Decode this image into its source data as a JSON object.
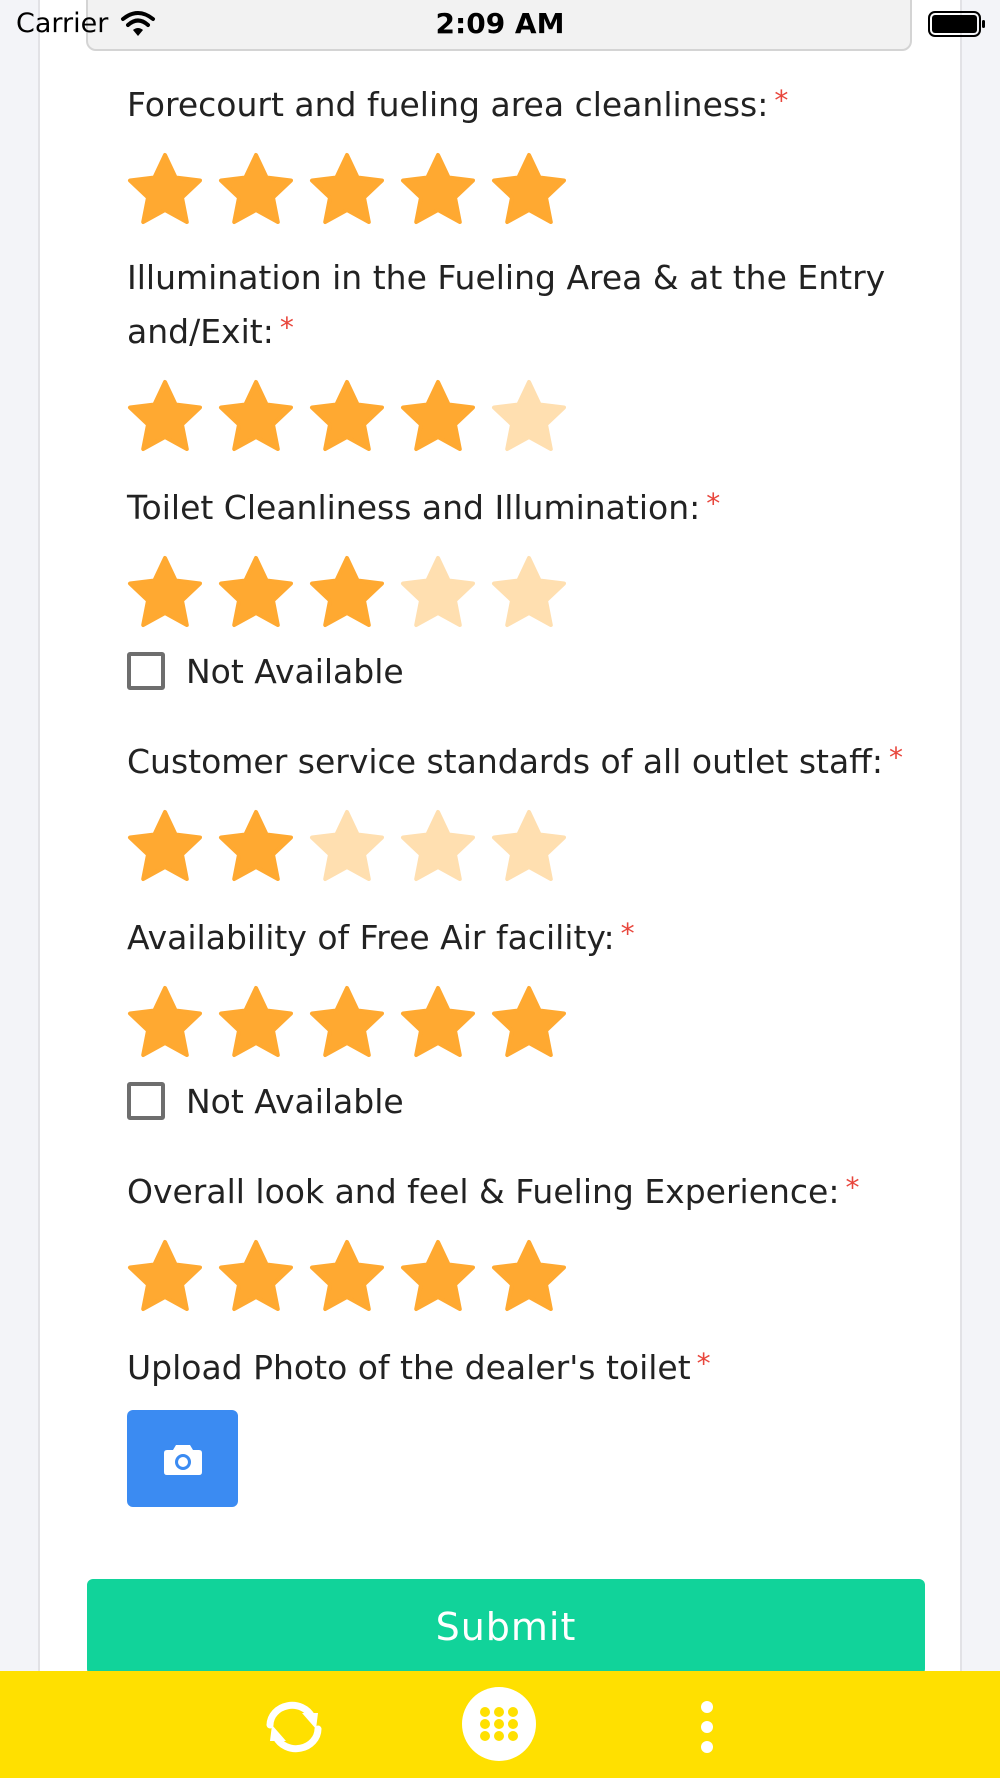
{
  "status_bar": {
    "carrier": "Carrier",
    "time": "2:09 AM"
  },
  "colors": {
    "star_filled": "#ffa931",
    "star_empty": "#ffdfb0",
    "required": "#e8463c",
    "camera_button": "#3b8bf2",
    "submit_button": "#11d39a",
    "bottom_bar": "#ffe000"
  },
  "questions": [
    {
      "label": "Forecourt and fueling area cleanliness:",
      "required": "*",
      "rating": 5,
      "max": 5
    },
    {
      "label": "Illumination in the Fueling Area & at the Entry and/Exit:",
      "required": "*",
      "rating": 4,
      "max": 5
    },
    {
      "label": "Toilet Cleanliness and Illumination:",
      "required": "*",
      "rating": 3,
      "max": 5,
      "not_available": {
        "label": "Not Available",
        "checked": false
      }
    },
    {
      "label": "Customer service standards of all outlet staff:",
      "required": "*",
      "rating": 2,
      "max": 5
    },
    {
      "label": "Availability of Free Air facility:",
      "required": "*",
      "rating": 5,
      "max": 5,
      "not_available": {
        "label": "Not Available",
        "checked": false
      }
    },
    {
      "label": "Overall look and feel & Fueling Experience:",
      "required": "*",
      "rating": 5,
      "max": 5
    }
  ],
  "upload": {
    "label": "Upload Photo of the dealer's toilet",
    "required": "*",
    "icon": "camera-icon"
  },
  "submit": {
    "label": "Submit"
  },
  "bottom_nav": {
    "icons": [
      "refresh-icon",
      "grid-menu-icon",
      "more-vertical-icon"
    ]
  }
}
